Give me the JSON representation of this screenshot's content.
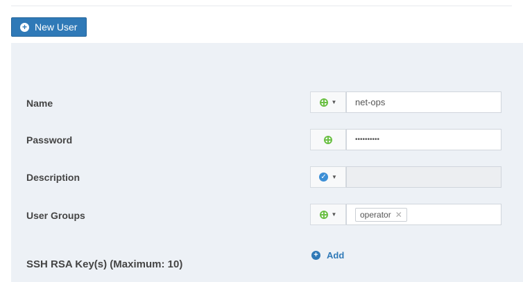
{
  "toolbar": {
    "new_user_label": "New User"
  },
  "form": {
    "name": {
      "label": "Name",
      "value": "net-ops"
    },
    "password": {
      "label": "Password",
      "value": "••••••••••"
    },
    "description": {
      "label": "Description",
      "value": ""
    },
    "user_groups": {
      "label": "User Groups",
      "tags": [
        "operator"
      ]
    },
    "ssh": {
      "label": "SSH RSA Key(s) (Maximum: 10)",
      "add_label": "Add"
    }
  },
  "colors": {
    "accent": "#2f79b7",
    "panel": "#edf1f6",
    "scope_green": "#6bc044",
    "check_blue": "#3d8fd6"
  }
}
